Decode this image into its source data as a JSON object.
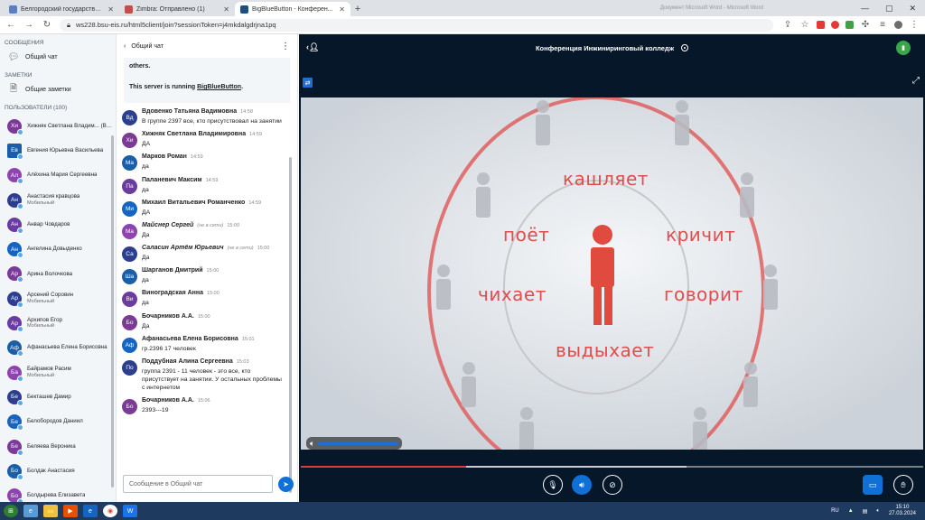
{
  "browser": {
    "tabs": [
      {
        "title": "Белгородский государственный...",
        "fav": "#5b7fbf"
      },
      {
        "title": "Zimbra: Отправлено (1)",
        "fav": "#c0504d"
      },
      {
        "title": "BigBlueButton - Конферен...",
        "fav": "#1f4e79",
        "active": true
      }
    ],
    "new_tab": "+",
    "title_fragment": "Документ Microsoft Word - Microsoft Word",
    "url": "ws228.bsu-eis.ru/html5client/join?sessionToken=j4mkdalgdrjna1pq"
  },
  "sidebar": {
    "messages_header": "СООБЩЕНИЯ",
    "public_chat": "Общий чат",
    "notes_header": "ЗАМЕТКИ",
    "shared_notes": "Общие заметки",
    "users_header": "ПОЛЬЗОВАТЕЛИ (100)",
    "users": [
      {
        "initials": "Хи",
        "name": "Хижняк Светлана Владим...",
        "you": "(Вы)",
        "color": "#7b3a96",
        "square": false
      },
      {
        "initials": "Ев",
        "name": "Евгения Юрьевна Васильева",
        "color": "#1a5ea8",
        "square": true
      },
      {
        "initials": "Ал",
        "name": "Алёхина Мария Сергеевна",
        "color": "#8e44ad"
      },
      {
        "initials": "Ан",
        "name": "Анастасия кравцова",
        "role": "Мобильный",
        "color": "#2c3e8f"
      },
      {
        "initials": "Ан",
        "name": "Анвар Човдаров",
        "color": "#6a3ca0"
      },
      {
        "initials": "Ан",
        "name": "Ангелина Довыденко",
        "color": "#1565c0"
      },
      {
        "initials": "Ар",
        "name": "Арина Волочкова",
        "color": "#7b3a96"
      },
      {
        "initials": "Ар",
        "name": "Арсений Соровин",
        "role": "Мобильный",
        "color": "#2c3e8f"
      },
      {
        "initials": "Ар",
        "name": "Архипов Егор",
        "role": "Мобильный",
        "color": "#6a3ca0"
      },
      {
        "initials": "Аф",
        "name": "Афанасьева Елена Борисовна",
        "color": "#1a5ea8"
      },
      {
        "initials": "Ба",
        "name": "Байрамов Расим",
        "role": "Мобильный",
        "color": "#8e44ad"
      },
      {
        "initials": "Бе",
        "name": "Бекташев Дамир",
        "color": "#2c3e8f"
      },
      {
        "initials": "Бе",
        "name": "Белобородов Даниил",
        "color": "#1565c0"
      },
      {
        "initials": "Бе",
        "name": "Беляева Вероника",
        "color": "#7b3a96"
      },
      {
        "initials": "Бо",
        "name": "Болдак Анастасия",
        "color": "#1a5ea8"
      },
      {
        "initials": "Бо",
        "name": "Болдырева Елизавета",
        "color": "#8e44ad"
      }
    ]
  },
  "chat": {
    "header": "Общий чат",
    "system_top": "others.",
    "system_line_prefix": "This server is running ",
    "system_link": "BigBlueButton",
    "system_suffix": ".",
    "messages": [
      {
        "initials": "Вд",
        "color": "#2c3e8f",
        "name": "Вдовенко Татьяна Вадимовна",
        "time": "14:58",
        "text": "В группе 2397 все, кто присутствовал на занятии"
      },
      {
        "initials": "Хи",
        "color": "#7b3a96",
        "name": "Хижняк Светлана Владимировна",
        "time": "14:59",
        "text": "ДА"
      },
      {
        "initials": "Ма",
        "color": "#1a5ea8",
        "name": "Марков Роман",
        "time": "14:59",
        "text": "да"
      },
      {
        "initials": "Па",
        "color": "#6a3ca0",
        "name": "Паланевич Максим",
        "time": "14:59",
        "text": "да"
      },
      {
        "initials": "Ми",
        "color": "#1565c0",
        "name": "Михаил Витальевич Романченко",
        "time": "14:59",
        "text": "ДА"
      },
      {
        "initials": "Ма",
        "color": "#8e44ad",
        "name": "Майснер Сергей",
        "offline": "(не в сети)",
        "time": "15:00",
        "text": "Да"
      },
      {
        "initials": "Са",
        "color": "#2c3e8f",
        "name": "Саласин Артём Юрьевич",
        "offline": "(не в сети)",
        "time": "15:00",
        "text": "Да"
      },
      {
        "initials": "Ша",
        "color": "#1a5ea8",
        "name": "Шарганов Дмитрий",
        "time": "15:00",
        "text": "да"
      },
      {
        "initials": "Ви",
        "color": "#6a3ca0",
        "name": "Виноградская Анна",
        "time": "15:00",
        "text": "да"
      },
      {
        "initials": "Бо",
        "color": "#7b3a96",
        "name": "Бочарников А.А.",
        "time": "15:00",
        "text": "Да"
      },
      {
        "initials": "Аф",
        "color": "#1565c0",
        "name": "Афанасьева Елена Борисовна",
        "time": "15:01",
        "text": "гр.2396 17 человек"
      },
      {
        "initials": "По",
        "color": "#2c3e8f",
        "name": "Поддубная Алина Сергеевна",
        "time": "15:03",
        "text": "группа 2391 - 11 человек - это все, кто присутствует на занятии. У остальных проблемы с интернетом"
      },
      {
        "initials": "Бо",
        "color": "#7b3a96",
        "name": "Бочарников А.А.",
        "time": "15:06",
        "text": "2393---19"
      }
    ],
    "input_placeholder": "Сообщение в Общий чат"
  },
  "conference": {
    "title": "Конференция Инжиниринговый колледж",
    "words": [
      "кашляет",
      "поёт",
      "кричит",
      "чихает",
      "говорит",
      "выдыхает"
    ],
    "playback_progress": 0.266,
    "buffered_to": 0.62
  },
  "taskbar": {
    "lang": "RU",
    "time": "15:10",
    "date": "27.03.2024"
  },
  "colors": {
    "accent": "#0f70d7",
    "video_red": "#e24c4c",
    "dark_bg": "#06172a"
  }
}
